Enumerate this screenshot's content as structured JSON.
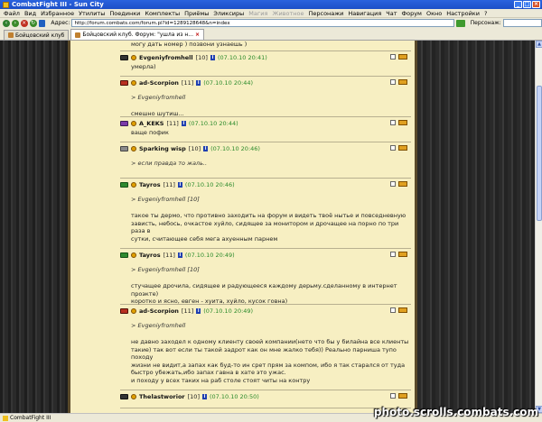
{
  "window": {
    "title": "CombatFight III - Sun City"
  },
  "menu": [
    "Файл",
    "Вид",
    "Избранное",
    "Утилиты",
    "Поединки",
    "Комплекты",
    "Приёмы",
    "Эликсиры",
    "Магия",
    "Животное",
    "Персонажи",
    "Навигация",
    "Чат",
    "Форум",
    "Окно",
    "Настройки",
    "?"
  ],
  "menu_disabled": [
    "Магия",
    "Животное"
  ],
  "address": {
    "label": "Адрес:",
    "url": "http://forum.combats.com/forum.pl?id=1289128648&n=index",
    "persons_label": "Персонаж:"
  },
  "tabs": [
    {
      "label": "Бойцовский клуб",
      "active": false
    },
    {
      "label": "Бойцовский клуб. Форум: \"ушла из н...",
      "active": true
    }
  ],
  "pre_text": "могу дать номер ) позвони узнаешь )",
  "posts": [
    {
      "nick": "Evgeniyfromhell",
      "level": "[10]",
      "time": "(07.10.10 20:41)",
      "clan": "dark",
      "quote": "",
      "body": [
        "умерла)"
      ]
    },
    {
      "nick": "ad-Scorpion",
      "level": "[11]",
      "time": "(07.10.10 20:44)",
      "clan": "red",
      "quote": "> Evgeniyfromhell",
      "body": [
        "смешно шутиш..."
      ]
    },
    {
      "nick": "A_KEKS",
      "level": "[11]",
      "time": "(07.10.10 20:44)",
      "clan": "purple",
      "quote": "",
      "body": [
        "ваще пофик"
      ]
    },
    {
      "nick": "Sparking wisp",
      "level": "[10]",
      "time": "(07.10.10 20:46)",
      "clan": "gray",
      "quote": "> если правда то жаль..",
      "body": []
    },
    {
      "nick": "Tayros",
      "level": "[11]",
      "time": "(07.10.10 20:46)",
      "clan": "green",
      "quote": "> Evgeniyfromhell [10]",
      "body": [
        "такое ты дермо, что противно заходить на форум и видеть твоё нытье и повседневную",
        "зависть, небось, очкастое хуйло, сидящее за монитором и дрочащее на порно по три раза в",
        "сутки, считающее себя мега ахуенным парнем"
      ]
    },
    {
      "nick": "Tayros",
      "level": "[11]",
      "time": "(07.10.10 20:49)",
      "clan": "green",
      "quote": "> Evgeniyfromhell [10]",
      "body": [
        "стучащее дрочила, сидящее и радующееся каждому дерьму.сделанному в интернет проэкте)",
        "коротко и ясно, евген - хуита, хуйло, кусок говна)"
      ]
    },
    {
      "nick": "ad-Scorpion",
      "level": "[11]",
      "time": "(07.10.10 20:49)",
      "clan": "red",
      "quote": "> Evgeniyfromhell",
      "body": [
        "не давно заходел к одному клиенту своей компании(нето что бы у билайна все клиенты",
        "такие) так вот если ты такой задрот как он мне жалко тебя)) Реально парниша тупо походу",
        "жизни не видит,а запах как буд-то ин срет прям за компом, ибо я так старался от туда",
        "быстро убежать,ибо запах гавна в хате это ужас.",
        "и походу у всех таких на раб столе стоят читы на контру"
      ]
    },
    {
      "nick": "Thelastworior",
      "level": "[10]",
      "time": "(07.10.10 20:50)",
      "clan": "dark",
      "quote": "",
      "body": []
    }
  ],
  "taskbar": {
    "item": "CombatFight III"
  },
  "watermark": "photo.scrolls.combats.com"
}
